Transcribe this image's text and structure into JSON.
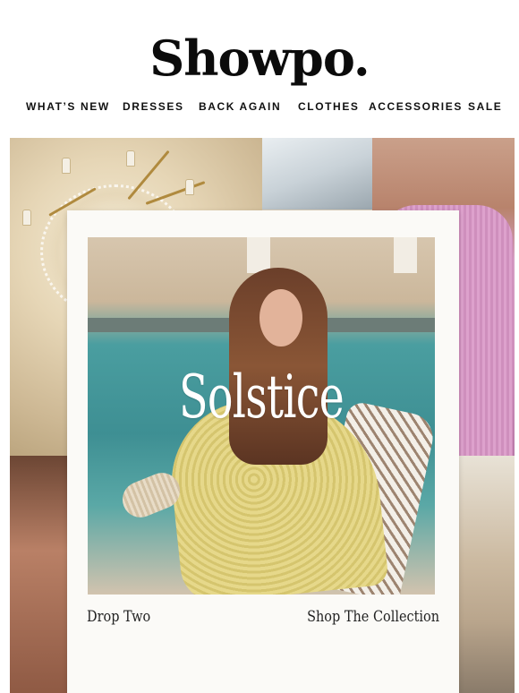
{
  "brand": {
    "logo_text": "Showpo."
  },
  "nav": {
    "items": [
      {
        "label": "WHAT’S NEW"
      },
      {
        "label": "DRESSES"
      },
      {
        "label": "BACK AGAIN"
      },
      {
        "label": "CLOTHES"
      },
      {
        "label": "ACCESSORIES"
      },
      {
        "label": "SALE"
      }
    ]
  },
  "hero": {
    "title": "Solstice",
    "caption_left": "Drop Two",
    "caption_right": "Shop The Collection"
  },
  "colors": {
    "background": "#ffffff",
    "text": "#111111",
    "polaroid": "#fbfaf7"
  }
}
